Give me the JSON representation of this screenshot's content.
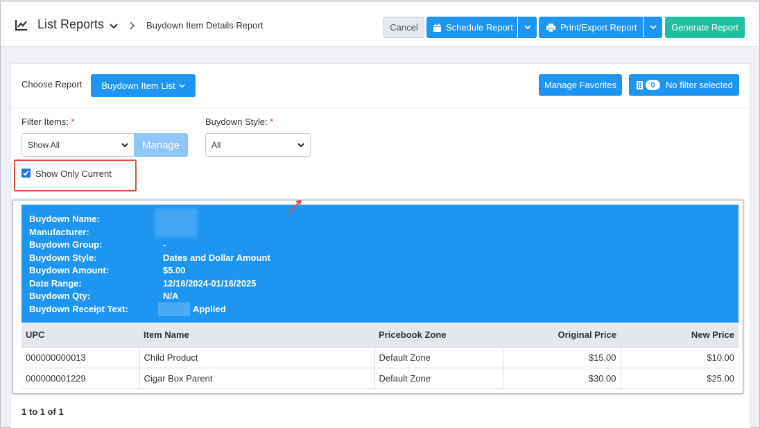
{
  "header": {
    "title": "List Reports",
    "breadcrumb": "Buydown Item Details Report",
    "cancel_label": "Cancel",
    "schedule_label": "Schedule Report",
    "print_label": "Print/Export Report",
    "generate_label": "Generate Report"
  },
  "controls": {
    "choose_label": "Choose Report",
    "choose_value": "Buydown Item List",
    "favorites_label": "Manage Favorites",
    "filter_count": "0",
    "filter_label": "No filter selected",
    "filter_items_label": "Filter Items:",
    "filter_items_value": "Show All",
    "manage_label": "Manage",
    "buydown_style_label": "Buydown Style:",
    "buydown_style_value": "All",
    "required_mark": "*",
    "show_only_current_label": "Show Only Current",
    "show_only_current_checked": true
  },
  "report": {
    "info_labels": [
      "Buydown Name:",
      "Manufacturer:",
      "Buydown Group:",
      "Buydown Style:",
      "Buydown Amount:",
      "Date Range:",
      "Buydown Qty:",
      "Buydown Receipt Text:"
    ],
    "info_values": [
      "",
      "",
      "-",
      "Dates and Dollar Amount",
      "$5.00",
      "12/16/2024-01/16/2025",
      "N/A",
      "Applied"
    ],
    "columns": [
      "UPC",
      "Item Name",
      "Pricebook Zone",
      "Original Price",
      "New Price"
    ],
    "rows": [
      [
        "000000000013",
        "Child Product",
        "Default Zone",
        "$15.00",
        "$10.00"
      ],
      [
        "000000001229",
        "Cigar Box Parent",
        "Default Zone",
        "$30.00",
        "$25.00"
      ]
    ]
  },
  "pager": "1 to 1 of 1",
  "colors": {
    "primary": "#1e95f0",
    "success": "#1fbfa0",
    "highlight": "#e04848"
  }
}
